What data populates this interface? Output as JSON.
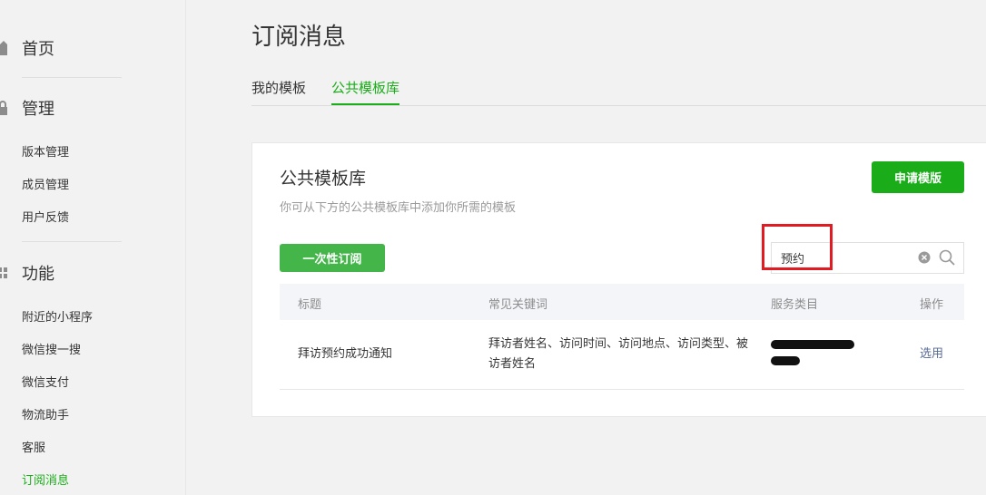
{
  "sidebar": {
    "home": {
      "label": "首页",
      "icon": "home-icon"
    },
    "manage": {
      "label": "管理",
      "icon": "lock-icon",
      "items": [
        "版本管理",
        "成员管理",
        "用户反馈"
      ]
    },
    "features": {
      "label": "功能",
      "icon": "grid-icon",
      "items": [
        "附近的小程序",
        "微信搜一搜",
        "微信支付",
        "物流助手",
        "客服",
        "订阅消息"
      ]
    },
    "active_item": "订阅消息"
  },
  "header": {
    "title": "订阅消息",
    "tabs": [
      {
        "label": "我的模板",
        "active": false
      },
      {
        "label": "公共模板库",
        "active": true
      }
    ]
  },
  "card": {
    "title": "公共模板库",
    "description": "你可从下方的公共模板库中添加你所需的模板",
    "apply_button": "申请模版",
    "filter_button": "一次性订阅",
    "search": {
      "value": "预约"
    },
    "table": {
      "headers": [
        "标题",
        "常见关键词",
        "服务类目",
        "操作"
      ],
      "rows": [
        {
          "title": "拜访预约成功通知",
          "keywords": "拜访者姓名、访问时间、访问地点、访问类型、被访者姓名",
          "category": "",
          "action": "选用"
        }
      ]
    }
  },
  "colors": {
    "accent": "#1aad19",
    "link": "#576b95",
    "highlight_box": "#e21a22"
  }
}
